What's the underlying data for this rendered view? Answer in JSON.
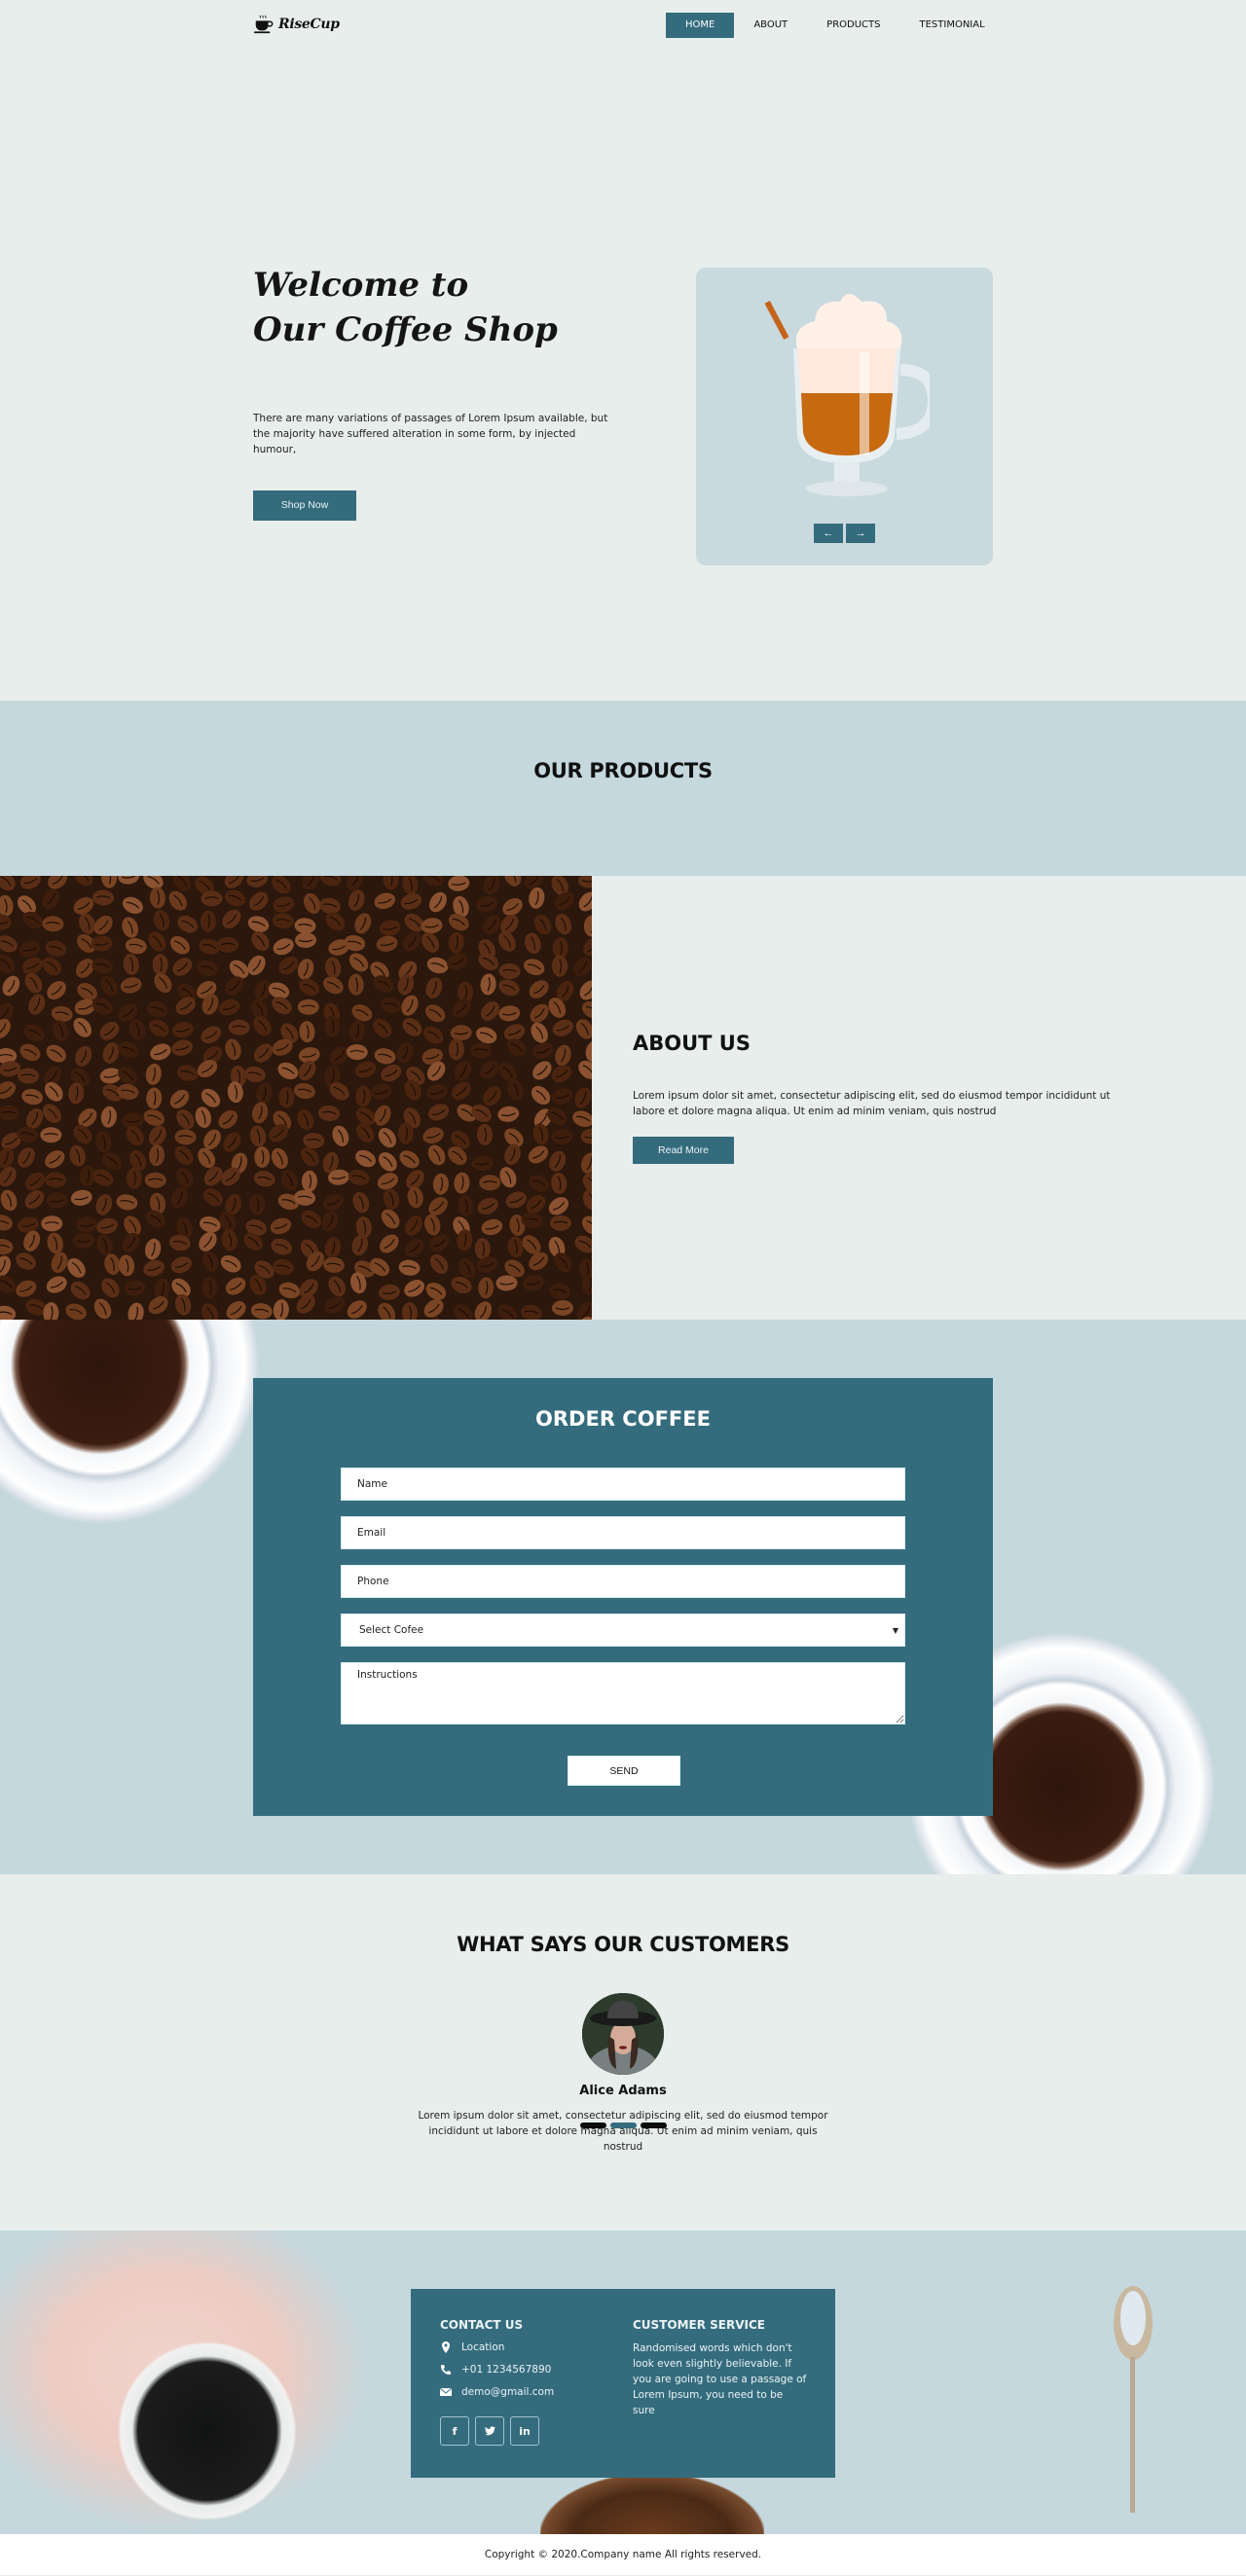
{
  "header": {
    "logo_text": "RiseCup",
    "nav": [
      {
        "label": "HOME",
        "active": true
      },
      {
        "label": "ABOUT",
        "active": false
      },
      {
        "label": "PRODUCTS",
        "active": false
      },
      {
        "label": "TESTIMONIAL",
        "active": false
      }
    ]
  },
  "hero": {
    "title_line1": "Welcome to",
    "title_line2": "Our Coffee Shop",
    "text": "There are many variations of passages of Lorem Ipsum available, but the majority have suffered alteration in some form, by injected humour,",
    "button": "Shop Now",
    "prev_arrow": "←",
    "next_arrow": "→"
  },
  "products": {
    "title": "OUR PRODUCTS"
  },
  "about": {
    "title": "ABOUT US",
    "text": "Lorem ipsum dolor sit amet, consectetur adipiscing elit, sed do eiusmod tempor incididunt ut labore et dolore magna aliqua. Ut enim ad minim veniam, quis nostrud",
    "button": "Read More"
  },
  "order": {
    "title": "ORDER COFFEE",
    "name_placeholder": "Name",
    "email_placeholder": "Email",
    "phone_placeholder": "Phone",
    "select_value": "Select Cofee",
    "instructions_placeholder": "Instructions",
    "send": "SEND"
  },
  "testimonial": {
    "title": "WHAT SAYS OUR CUSTOMERS",
    "name": "Alice Adams",
    "text": "Lorem ipsum dolor sit amet, consectetur adipiscing elit, sed do eiusmod tempor incididunt ut labore et dolore magna aliqua. Ut enim ad minim veniam, quis nostrud",
    "active_indicator": 2,
    "indicator_count": 3
  },
  "info": {
    "contact_title": "CONTACT US",
    "location": "Location",
    "phone": "+01 1234567890",
    "email": "demo@gmail.com",
    "socials": [
      {
        "name": "facebook",
        "glyph": "f"
      },
      {
        "name": "twitter",
        "glyph": "t"
      },
      {
        "name": "linkedin",
        "glyph": "in"
      }
    ],
    "service_title": "CUSTOMER SERVICE",
    "service_text": "Randomised words which don't look even slightly believable. If you are going to use a passage of Lorem Ipsum, you need to be sure"
  },
  "footer": {
    "copyright": "Copyright © 2020.Company name All rights reserved."
  },
  "colors": {
    "accent": "#356c7d",
    "background": "#e7eeec",
    "section_alt": "#c5d8dd"
  }
}
